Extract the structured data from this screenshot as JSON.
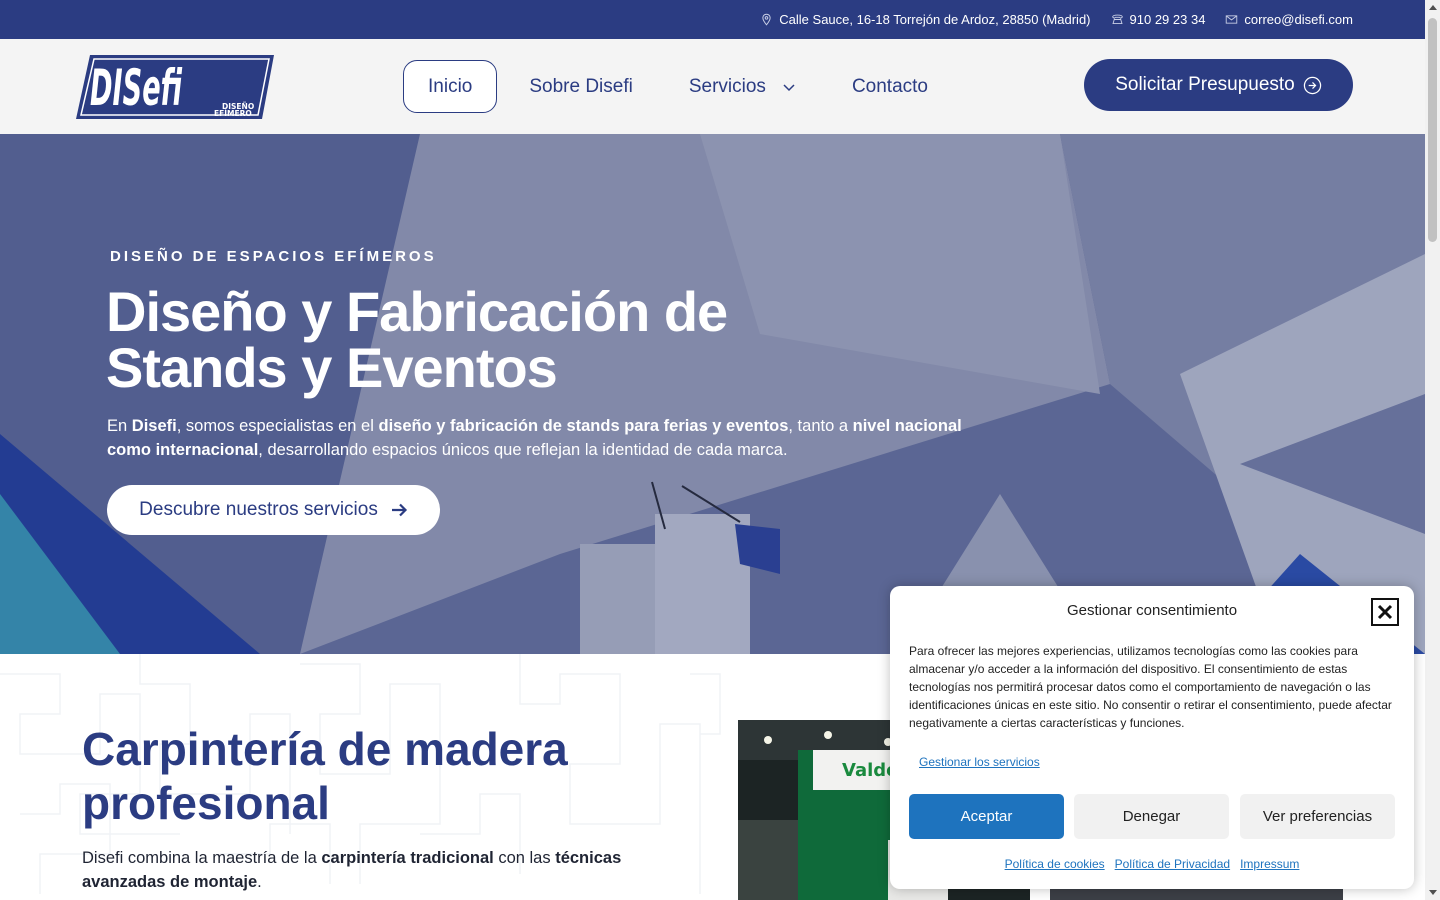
{
  "colors": {
    "brand": "#2b3c82",
    "consent_accent": "#1e73be",
    "header_bg": "#f4f4f4"
  },
  "topbar": {
    "address": "Calle Sauce, 16-18 Torrejón de Ardoz, 28850 (Madrid)",
    "phone": "910 29 23 34",
    "email": "correo@disefi.com",
    "icons": [
      "map-pin-icon",
      "phone-icon",
      "mail-icon"
    ]
  },
  "header": {
    "logo_text": "DISefi",
    "logo_sub1": "DISEÑO",
    "logo_sub2": "EFÍMERO",
    "nav": {
      "inicio": "Inicio",
      "sobre": "Sobre Disefi",
      "servicios": "Servicios",
      "contacto": "Contacto"
    },
    "cta_label": "Solicitar Presupuesto"
  },
  "hero": {
    "eyebrow": "DISEÑO DE ESPACIOS EFÍMEROS",
    "title_line1": "Diseño y Fabricación de",
    "title_line2": "Stands y Eventos",
    "lead": {
      "p1": "En ",
      "b1": "Disefi",
      "p2": ", somos especialistas en el ",
      "b2": "diseño y fabricación de stands para ferias y eventos",
      "p3": ", tanto a ",
      "b3": "nivel nacional como internacional",
      "p4": ", desarrollando espacios únicos que reflejan la identidad de cada marca."
    },
    "button_label": "Descubre nuestros servicios"
  },
  "section": {
    "title_line1": "Carpintería de madera",
    "title_line2": "profesional",
    "para": {
      "p1": "Disefi combina la maestría de la ",
      "b1": "carpintería tradicional",
      "p2": " con las ",
      "b2": "técnicas avanzadas de montaje",
      "p3": "."
    },
    "photo_sign": "Valdent"
  },
  "consent": {
    "title": "Gestionar consentimiento",
    "message": "Para ofrecer las mejores experiencias, utilizamos tecnologías como las cookies para almacenar y/o acceder a la información del dispositivo. El consentimiento de estas tecnologías nos permitirá procesar datos como el comportamiento de navegación o las identificaciones únicas en este sitio. No consentir o retirar el consentimiento, puede afectar negativamente a ciertas características y funciones.",
    "manage_link": "Gestionar los servicios",
    "accept": "Aceptar",
    "deny": "Denegar",
    "preferences": "Ver preferencias",
    "links": {
      "cookies": "Política de cookies",
      "privacy": "Política de Privacidad",
      "impressum": "Impressum"
    }
  }
}
